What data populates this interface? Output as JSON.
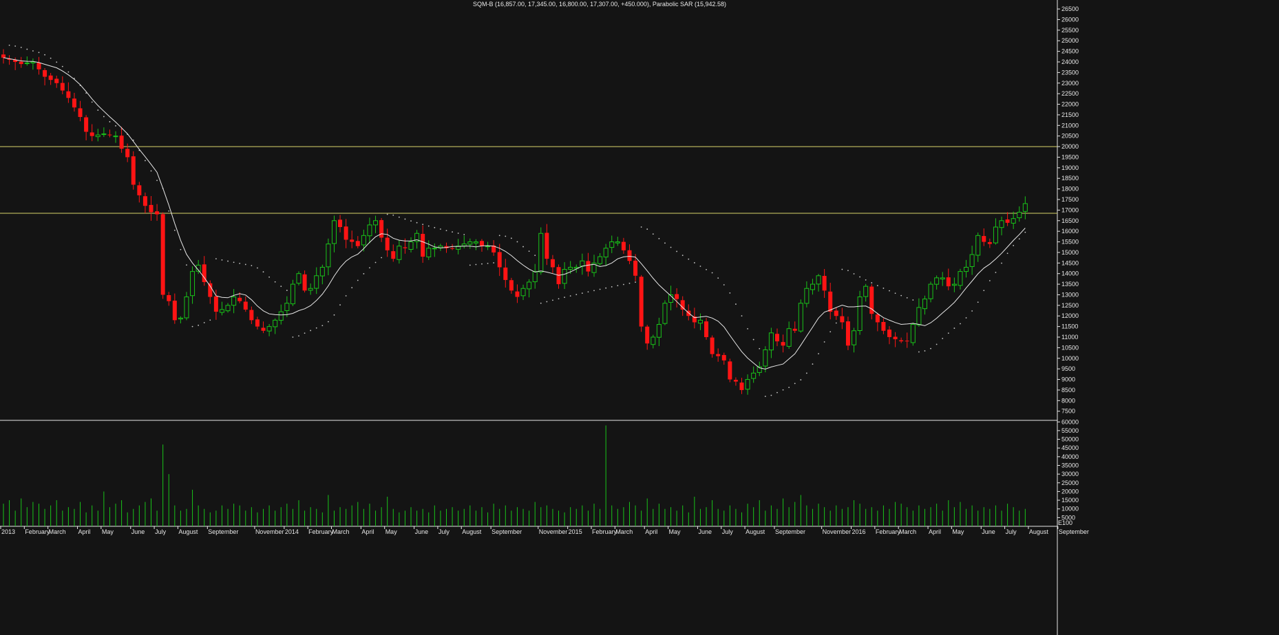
{
  "header": {
    "title": "SQM-B (16,857.00, 17,345.00, 16,800.00, 17,307.00, +450.000), Parabolic SAR (15,942.58)"
  },
  "colors": {
    "background": "#141414",
    "up": "#19c419",
    "down": "#ff1414",
    "ma": "#e8e8e8",
    "sar": "#c8c8c8",
    "hline": "#d9d36a",
    "volume": "#19c419",
    "axis": "#e8e8e8"
  },
  "chart_data": [
    {
      "type": "candlestick",
      "title": "SQM-B (16,857.00, 17,345.00, 16,800.00, 17,307.00, +450.000), Parabolic SAR (15,942.58)",
      "ylim": [
        7100,
        26600
      ],
      "ytick_step": 500,
      "yticks_min": 7500,
      "yticks_max": 26500,
      "horizontal_lines": [
        20000,
        16850
      ],
      "x_labels": [
        "2013",
        "February",
        "March",
        "April",
        "May",
        "June",
        "July",
        "August",
        "September",
        "November",
        "2014",
        "February",
        "March",
        "April",
        "May",
        "June",
        "July",
        "August",
        "September",
        "November",
        "2015",
        "February",
        "March",
        "April",
        "May",
        "June",
        "July",
        "August",
        "September",
        "November",
        "2016",
        "February",
        "March",
        "April",
        "May",
        "June",
        "July",
        "August",
        "September"
      ],
      "x_label_weeks": [
        0,
        4,
        8,
        13,
        17,
        22,
        26,
        30,
        35,
        43,
        48,
        52,
        56,
        61,
        65,
        70,
        74,
        78,
        83,
        91,
        96,
        100,
        104,
        109,
        113,
        118,
        122,
        126,
        131,
        139,
        144,
        148,
        152,
        157,
        161,
        166,
        170,
        174,
        179
      ],
      "series": [
        {
          "name": "SQM-B",
          "close_points": [
            [
              0,
              24200
            ],
            [
              3,
              23900
            ],
            [
              5,
              24000
            ],
            [
              7,
              23300
            ],
            [
              9,
              23000
            ],
            [
              11,
              22300
            ],
            [
              13,
              21400
            ],
            [
              14,
              20700
            ],
            [
              15,
              20500
            ],
            [
              17,
              20600
            ],
            [
              19,
              20500
            ],
            [
              20,
              19900
            ],
            [
              21,
              19500
            ],
            [
              22,
              18200
            ],
            [
              23,
              17700
            ],
            [
              24,
              17200
            ],
            [
              25,
              16900
            ],
            [
              26,
              16800
            ],
            [
              27,
              13000
            ],
            [
              28,
              12700
            ],
            [
              29,
              11800
            ],
            [
              30,
              11900
            ],
            [
              31,
              12900
            ],
            [
              32,
              14100
            ],
            [
              33,
              14400
            ],
            [
              34,
              13600
            ],
            [
              35,
              12900
            ],
            [
              36,
              12200
            ],
            [
              37,
              12300
            ],
            [
              38,
              12500
            ],
            [
              39,
              12900
            ],
            [
              40,
              12700
            ],
            [
              41,
              12300
            ],
            [
              42,
              11800
            ],
            [
              43,
              11500
            ],
            [
              44,
              11300
            ],
            [
              45,
              11500
            ],
            [
              46,
              11800
            ],
            [
              47,
              12200
            ],
            [
              48,
              12600
            ],
            [
              49,
              13500
            ],
            [
              50,
              14000
            ],
            [
              51,
              13200
            ],
            [
              52,
              13300
            ],
            [
              53,
              13900
            ],
            [
              54,
              14300
            ],
            [
              55,
              15400
            ],
            [
              56,
              16500
            ],
            [
              57,
              16200
            ],
            [
              58,
              15600
            ],
            [
              59,
              15500
            ],
            [
              60,
              15300
            ],
            [
              61,
              15800
            ],
            [
              62,
              16300
            ],
            [
              63,
              16500
            ],
            [
              64,
              15700
            ],
            [
              65,
              15100
            ],
            [
              66,
              14700
            ],
            [
              67,
              15300
            ],
            [
              68,
              15200
            ],
            [
              69,
              15500
            ],
            [
              70,
              15900
            ],
            [
              71,
              14800
            ],
            [
              72,
              15200
            ],
            [
              73,
              15200
            ],
            [
              74,
              15300
            ],
            [
              75,
              15200
            ],
            [
              76,
              15200
            ],
            [
              77,
              15300
            ],
            [
              78,
              15400
            ],
            [
              79,
              15500
            ],
            [
              80,
              15500
            ],
            [
              81,
              15300
            ],
            [
              82,
              15300
            ],
            [
              83,
              15000
            ],
            [
              84,
              14300
            ],
            [
              85,
              13700
            ],
            [
              86,
              13200
            ],
            [
              87,
              12900
            ],
            [
              88,
              13300
            ],
            [
              89,
              13600
            ],
            [
              90,
              14100
            ],
            [
              91,
              15900
            ],
            [
              92,
              14700
            ],
            [
              93,
              14300
            ],
            [
              94,
              13500
            ],
            [
              95,
              14200
            ],
            [
              96,
              14300
            ],
            [
              97,
              14300
            ],
            [
              98,
              14600
            ],
            [
              99,
              14100
            ],
            [
              100,
              14500
            ],
            [
              101,
              14800
            ],
            [
              102,
              15200
            ],
            [
              103,
              15500
            ],
            [
              104,
              15500
            ],
            [
              105,
              15100
            ],
            [
              106,
              14600
            ],
            [
              107,
              13900
            ],
            [
              108,
              11500
            ],
            [
              109,
              10700
            ],
            [
              110,
              11000
            ],
            [
              111,
              11600
            ],
            [
              112,
              12600
            ],
            [
              113,
              13000
            ],
            [
              114,
              12800
            ],
            [
              115,
              12300
            ],
            [
              116,
              12000
            ],
            [
              117,
              11700
            ],
            [
              118,
              11800
            ],
            [
              119,
              11000
            ],
            [
              120,
              10200
            ],
            [
              121,
              10100
            ],
            [
              122,
              9900
            ],
            [
              123,
              9000
            ],
            [
              124,
              8900
            ],
            [
              125,
              8500
            ],
            [
              126,
              9000
            ],
            [
              127,
              9300
            ],
            [
              128,
              9600
            ],
            [
              129,
              10400
            ],
            [
              130,
              11200
            ],
            [
              131,
              10800
            ],
            [
              132,
              10600
            ],
            [
              133,
              11400
            ],
            [
              134,
              11300
            ],
            [
              135,
              12600
            ],
            [
              136,
              13300
            ],
            [
              137,
              13500
            ],
            [
              138,
              13900
            ],
            [
              139,
              13200
            ],
            [
              140,
              12200
            ],
            [
              141,
              12000
            ],
            [
              142,
              11700
            ],
            [
              143,
              10600
            ],
            [
              144,
              11300
            ],
            [
              145,
              12900
            ],
            [
              146,
              13400
            ],
            [
              147,
              12100
            ],
            [
              148,
              11700
            ],
            [
              149,
              11300
            ],
            [
              150,
              11000
            ],
            [
              151,
              10900
            ],
            [
              152,
              10800
            ],
            [
              153,
              10800
            ],
            [
              154,
              11600
            ],
            [
              155,
              12400
            ],
            [
              156,
              12800
            ],
            [
              157,
              13500
            ],
            [
              158,
              13800
            ],
            [
              159,
              13800
            ],
            [
              160,
              13400
            ],
            [
              161,
              13500
            ],
            [
              162,
              14100
            ],
            [
              163,
              14300
            ],
            [
              164,
              14900
            ],
            [
              165,
              15800
            ],
            [
              166,
              15500
            ],
            [
              167,
              15400
            ],
            [
              168,
              16200
            ],
            [
              169,
              16500
            ],
            [
              170,
              16400
            ],
            [
              171,
              16600
            ],
            [
              172,
              16900
            ],
            [
              173,
              17307
            ]
          ]
        }
      ]
    },
    {
      "type": "bar",
      "title": "",
      "ylim": [
        0,
        60500
      ],
      "ytick_step": 5000,
      "yticks_min": 5000,
      "yticks_max": 60000,
      "axis_extra_label": "E100",
      "series": [
        {
          "name": "Volume",
          "values": [
            13000,
            15000,
            9000,
            16000,
            11000,
            14000,
            13000,
            10000,
            12000,
            15000,
            9000,
            11000,
            10000,
            14000,
            8000,
            12000,
            9000,
            20000,
            11000,
            13000,
            15000,
            8000,
            10000,
            12000,
            14000,
            16000,
            9000,
            47000,
            30000,
            12000,
            9000,
            10000,
            21000,
            12000,
            10000,
            8000,
            9000,
            12000,
            10000,
            13000,
            12000,
            9000,
            11000,
            8000,
            10000,
            12000,
            9000,
            11000,
            13000,
            10000,
            15000,
            9000,
            11000,
            10000,
            8000,
            18000,
            9000,
            11000,
            10000,
            12000,
            14000,
            10000,
            13000,
            9000,
            11000,
            17000,
            10000,
            8000,
            9000,
            11000,
            9000,
            10000,
            8000,
            12000,
            9000,
            10000,
            11000,
            9000,
            10000,
            12000,
            9000,
            11000,
            8000,
            13000,
            10000,
            12000,
            9000,
            11000,
            10000,
            9000,
            14000,
            11000,
            12000,
            10000,
            9000,
            8000,
            11000,
            10000,
            12000,
            9000,
            13000,
            10000,
            58000,
            12000,
            10000,
            11000,
            14000,
            12000,
            9000,
            16000,
            10000,
            13000,
            10000,
            11000,
            9000,
            12000,
            8000,
            17000,
            10000,
            11000,
            15000,
            10000,
            9000,
            12000,
            10000,
            8000,
            13000,
            11000,
            15000,
            9000,
            12000,
            10000,
            16000,
            11000,
            14000,
            18000,
            12000,
            10000,
            13000,
            11000,
            9000,
            12000,
            10000,
            11000,
            15000,
            13000,
            10000,
            11000,
            9000,
            12000,
            10000,
            14000,
            13000,
            11000,
            9000,
            12000,
            10000,
            11000,
            13000,
            9000,
            15000,
            11000,
            14000,
            10000,
            12000,
            9000,
            11000,
            10000,
            12000,
            9000,
            13000,
            11000,
            9000,
            10000
          ]
        }
      ]
    }
  ]
}
